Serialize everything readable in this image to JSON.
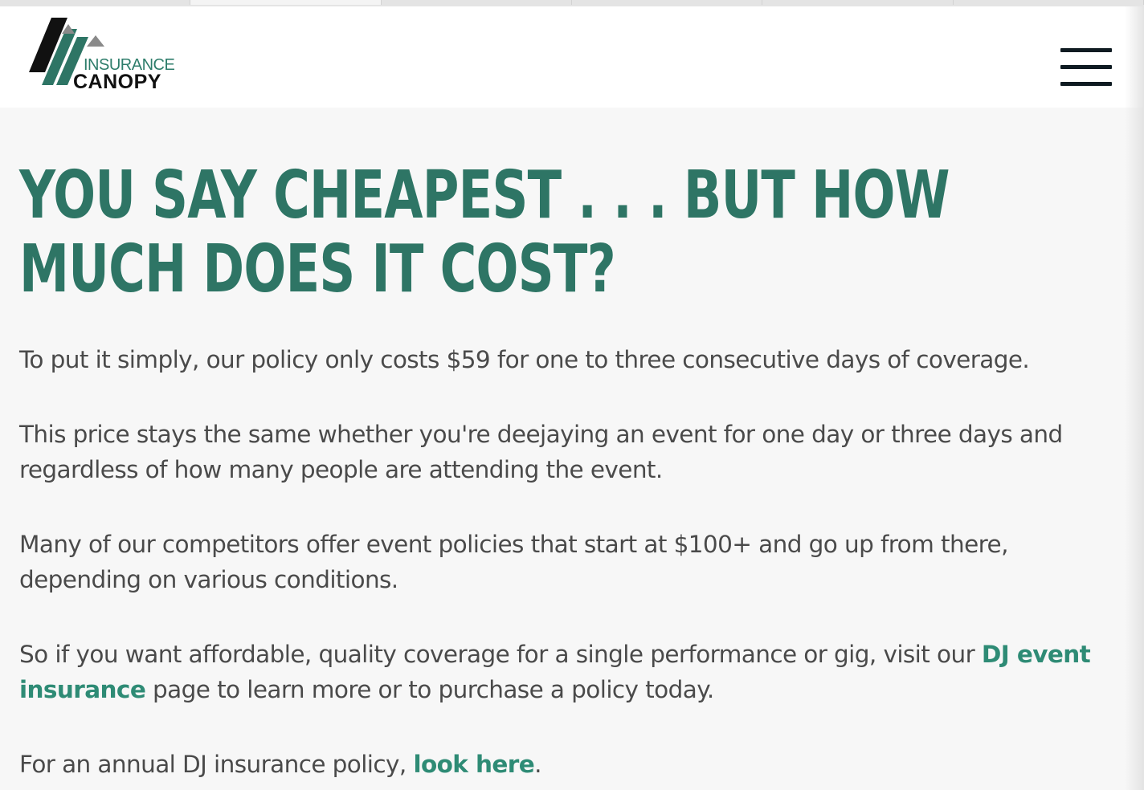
{
  "browser": {
    "tabs": [
      "",
      "",
      "",
      "",
      "",
      ""
    ],
    "active_tab_index": 0
  },
  "header": {
    "logo": {
      "line1": "INSURANCE",
      "line2": "CANOPY"
    },
    "menu_icon": "hamburger-menu-icon"
  },
  "article": {
    "headline": "YOU SAY CHEAPEST . . . BUT HOW MUCH DOES IT COST?",
    "p1": "To put it simply, our policy only costs $59 for one to three consecutive days of coverage.",
    "p2": "This price stays the same whether you're deejaying an event for one day or three days and regardless of how many people are attending the event.",
    "p3": "Many of our competitors offer event policies that start at $100+ and go up from there, depending on various conditions.",
    "p4": {
      "before": "So if you want affordable, quality coverage for a single performance or gig, visit our ",
      "link": "DJ event insurance",
      "after": " page to learn more or to purchase a policy today."
    },
    "p5": {
      "before": "For an annual DJ insurance policy, ",
      "link": "look here",
      "after": "."
    }
  },
  "colors": {
    "brand_green": "#2e7565",
    "link_green": "#2e8b75",
    "body_text": "#4a4a4a",
    "page_background": "#f7f7f7",
    "header_background": "#ffffff"
  }
}
